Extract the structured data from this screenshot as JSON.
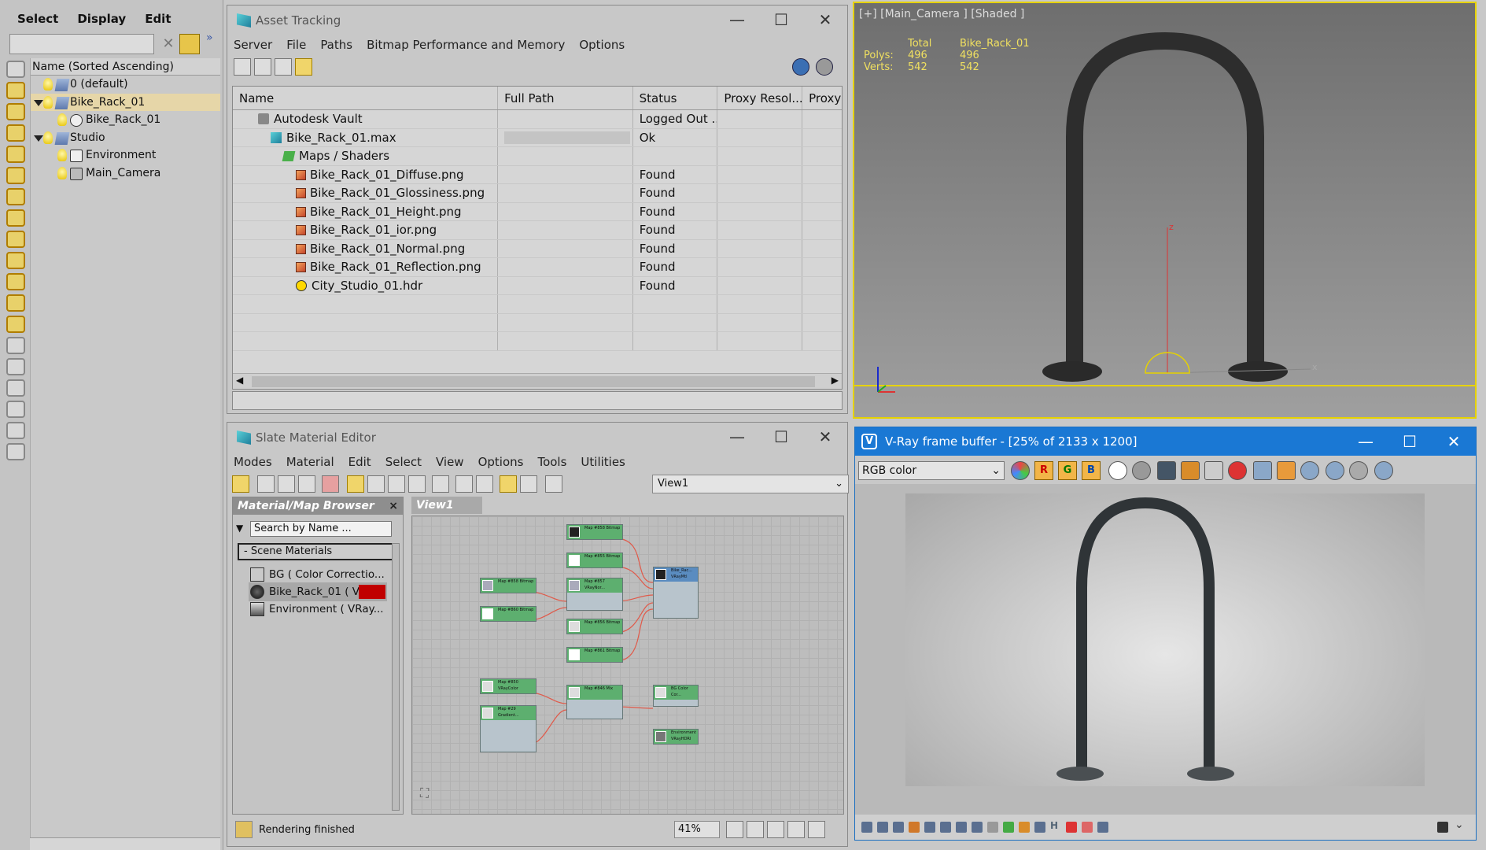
{
  "scene_explorer": {
    "menus": [
      "Select",
      "Display",
      "Edit"
    ],
    "column_header": "Name (Sorted Ascending)",
    "tree": [
      {
        "label": "0 (default)",
        "depth": 0,
        "type": "layer"
      },
      {
        "label": "Bike_Rack_01",
        "depth": 0,
        "type": "layer",
        "expanded": true
      },
      {
        "label": "Bike_Rack_01",
        "depth": 1,
        "type": "object"
      },
      {
        "label": "Studio",
        "depth": 0,
        "type": "layer",
        "expanded": true
      },
      {
        "label": "Environment",
        "depth": 1,
        "type": "object"
      },
      {
        "label": "Main_Camera",
        "depth": 1,
        "type": "camera"
      }
    ]
  },
  "asset_tracking": {
    "title": "Asset Tracking",
    "menus": [
      "Server",
      "File",
      "Paths",
      "Bitmap Performance and Memory",
      "Options"
    ],
    "columns": [
      "Name",
      "Full Path",
      "Status",
      "Proxy Resol...",
      "Proxy S"
    ],
    "rows": [
      {
        "name": "Autodesk Vault",
        "status": "Logged Out ...",
        "icon": "vault-icon"
      },
      {
        "name": "Bike_Rack_01.max",
        "status": "Ok",
        "icon": "max-file-icon"
      },
      {
        "name": "Maps / Shaders",
        "status": "",
        "icon": "maps-icon"
      },
      {
        "name": "Bike_Rack_01_Diffuse.png",
        "status": "Found",
        "icon": "image-file-icon"
      },
      {
        "name": "Bike_Rack_01_Glossiness.png",
        "status": "Found",
        "icon": "image-file-icon"
      },
      {
        "name": "Bike_Rack_01_Height.png",
        "status": "Found",
        "icon": "image-file-icon"
      },
      {
        "name": "Bike_Rack_01_ior.png",
        "status": "Found",
        "icon": "image-file-icon"
      },
      {
        "name": "Bike_Rack_01_Normal.png",
        "status": "Found",
        "icon": "image-file-icon"
      },
      {
        "name": "Bike_Rack_01_Reflection.png",
        "status": "Found",
        "icon": "image-file-icon"
      },
      {
        "name": "City_Studio_01.hdr",
        "status": "Found",
        "icon": "hdr-smiley-icon"
      }
    ]
  },
  "viewport": {
    "label": "[+] [Main_Camera ] [Shaded ]",
    "stats": {
      "col_total": "Total",
      "col_object": "Bike_Rack_01",
      "polys_label": "Polys:",
      "polys_total": "496",
      "polys_object": "496",
      "verts_label": "Verts:",
      "verts_total": "542",
      "verts_object": "542"
    },
    "axis_z": "z",
    "axis_x": "x"
  },
  "slate": {
    "title": "Slate Material Editor",
    "menus": [
      "Modes",
      "Material",
      "Edit",
      "Select",
      "View",
      "Options",
      "Tools",
      "Utilities"
    ],
    "view_select": "View1",
    "browser_title": "Material/Map Browser",
    "search_placeholder": "Search by Name ...",
    "scene_materials": "- Scene Materials",
    "materials": [
      "BG ( Color Correctio...",
      "Bike_Rack_01 ( VRa",
      "Environment ( VRay..."
    ],
    "view_tab": "View1",
    "status": "Rendering finished",
    "zoom": "41%",
    "nodes": [
      {
        "label": "Map #858 Bitmap"
      },
      {
        "label": "Map #855 Bitmap"
      },
      {
        "label": "Map #858 Bitmap"
      },
      {
        "label": "Map #857 VRayNor..."
      },
      {
        "label": "Map #860 Bitmap"
      },
      {
        "label": "Map #856 Bitmap"
      },
      {
        "label": "Map #861 Bitmap"
      },
      {
        "label": "Bike_Rac... VRayMtl"
      },
      {
        "label": "Map #850 VRayColor"
      },
      {
        "label": "Map #846 Mix"
      },
      {
        "label": "Map #29 Gradient..."
      },
      {
        "label": "BG Color Cor..."
      },
      {
        "label": "Environment VRayHDRI"
      }
    ]
  },
  "vray": {
    "title": "V-Ray frame buffer - [25% of 2133 x 1200]",
    "channel": "RGB color",
    "r": "R",
    "g": "G",
    "b": "B"
  },
  "window_controls": {
    "minimize": "—",
    "maximize": "☐",
    "close": "✕"
  },
  "colors": {
    "viewport_border": "#e6d200",
    "vray_title_bg": "#1a78d4",
    "node_header": "#5daf6f",
    "wire": "#e05a4a"
  }
}
